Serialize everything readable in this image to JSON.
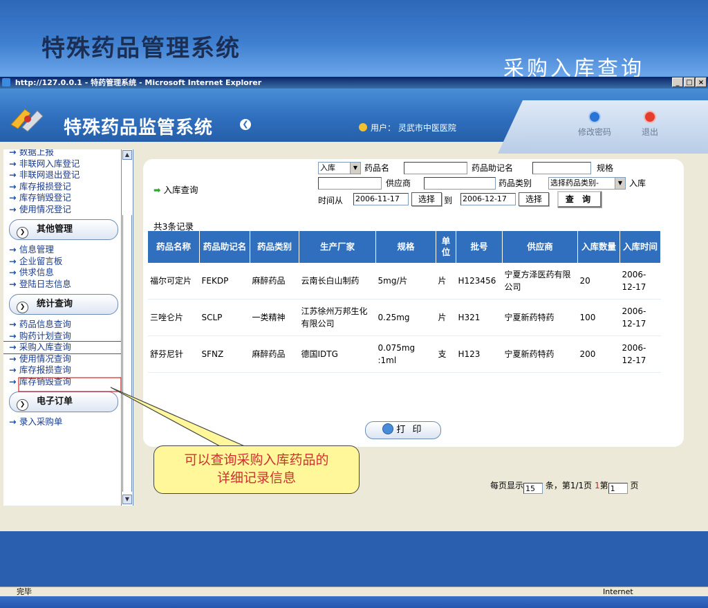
{
  "slide": {
    "title": "特殊药品管理系统",
    "subtitle": "采购入库查询",
    "callout_line1": "可以查询采购入库药品的",
    "callout_line2": "详细记录信息"
  },
  "browser": {
    "window_title": "http://127.0.0.1 - 特药管理系统 - Microsoft Internet Explorer",
    "status_text": "完毕",
    "zone_text": "Internet"
  },
  "app": {
    "name": "特殊药品监管系统",
    "user_label": "用户：",
    "user_name": "灵武市中医医院",
    "change_password": "修改密码",
    "logout": "退出"
  },
  "sidebar": {
    "top_links": [
      "数据上报",
      "非联网入库登记",
      "非联网退出登记",
      "库存报损登记",
      "库存销毁登记",
      "使用情况登记"
    ],
    "groups": [
      {
        "label": "其他管理",
        "links": [
          "信息管理",
          "企业留言板",
          "供求信息",
          "登陆日志信息"
        ]
      },
      {
        "label": "统计查询",
        "links": [
          "药品信息查询",
          "购药计划查询",
          "采购入库查询",
          "使用情况查询",
          "库存报损查询",
          "库存销毁查询"
        ]
      },
      {
        "label": "电子订单",
        "links": [
          "录入采购单"
        ]
      }
    ]
  },
  "search": {
    "page_label": "入库查询",
    "type_select": "入库",
    "drug_name_label": "药品名",
    "drug_name_value": "",
    "mnemonic_label": "药品助记名",
    "mnemonic_value": "",
    "spec_label": "规格",
    "spec_value": "",
    "supplier_label": "供应商",
    "supplier_value": "",
    "category_label": "药品类别",
    "category_select": "选择药品类别-",
    "suffix_label": "入库",
    "time_from_label": "时间从",
    "date_from": "2006-11-17",
    "to_label": "到",
    "date_to": "2006-12-17",
    "choose_label": "选择",
    "query_button": "查 询"
  },
  "results": {
    "count_text": "共3条记录",
    "columns": [
      "药品名称",
      "药品助记名",
      "药品类别",
      "生产厂家",
      "规格",
      "单位",
      "批号",
      "供应商",
      "入库数量",
      "入库时间"
    ],
    "rows": [
      [
        "福尔可定片",
        "FEKDP",
        "麻醉药品",
        "云南长白山制药",
        "5mg/片",
        "片",
        "H123456",
        "宁夏方泽医药有限公司",
        "20",
        "2006-12-17"
      ],
      [
        "三唑仑片",
        "SCLP",
        "一类精神",
        "江苏徐州万邦生化有限公司",
        "0.25mg",
        "片",
        "H321",
        "宁夏新药特药",
        "100",
        "2006-12-17"
      ],
      [
        "舒芬尼针",
        "SFNZ",
        "麻醉药品",
        "德国IDTG",
        "0.075mg :1ml",
        "支",
        "H123",
        "宁夏新药特药",
        "200",
        "2006-12-17"
      ]
    ]
  },
  "pager": {
    "prefix": "每页显示",
    "page_size": "15",
    "mid": "条，第1/1页",
    "current": "1",
    "goto_prefix": "第",
    "goto_value": "1",
    "goto_suffix": "页"
  },
  "print_button": "打 印"
}
